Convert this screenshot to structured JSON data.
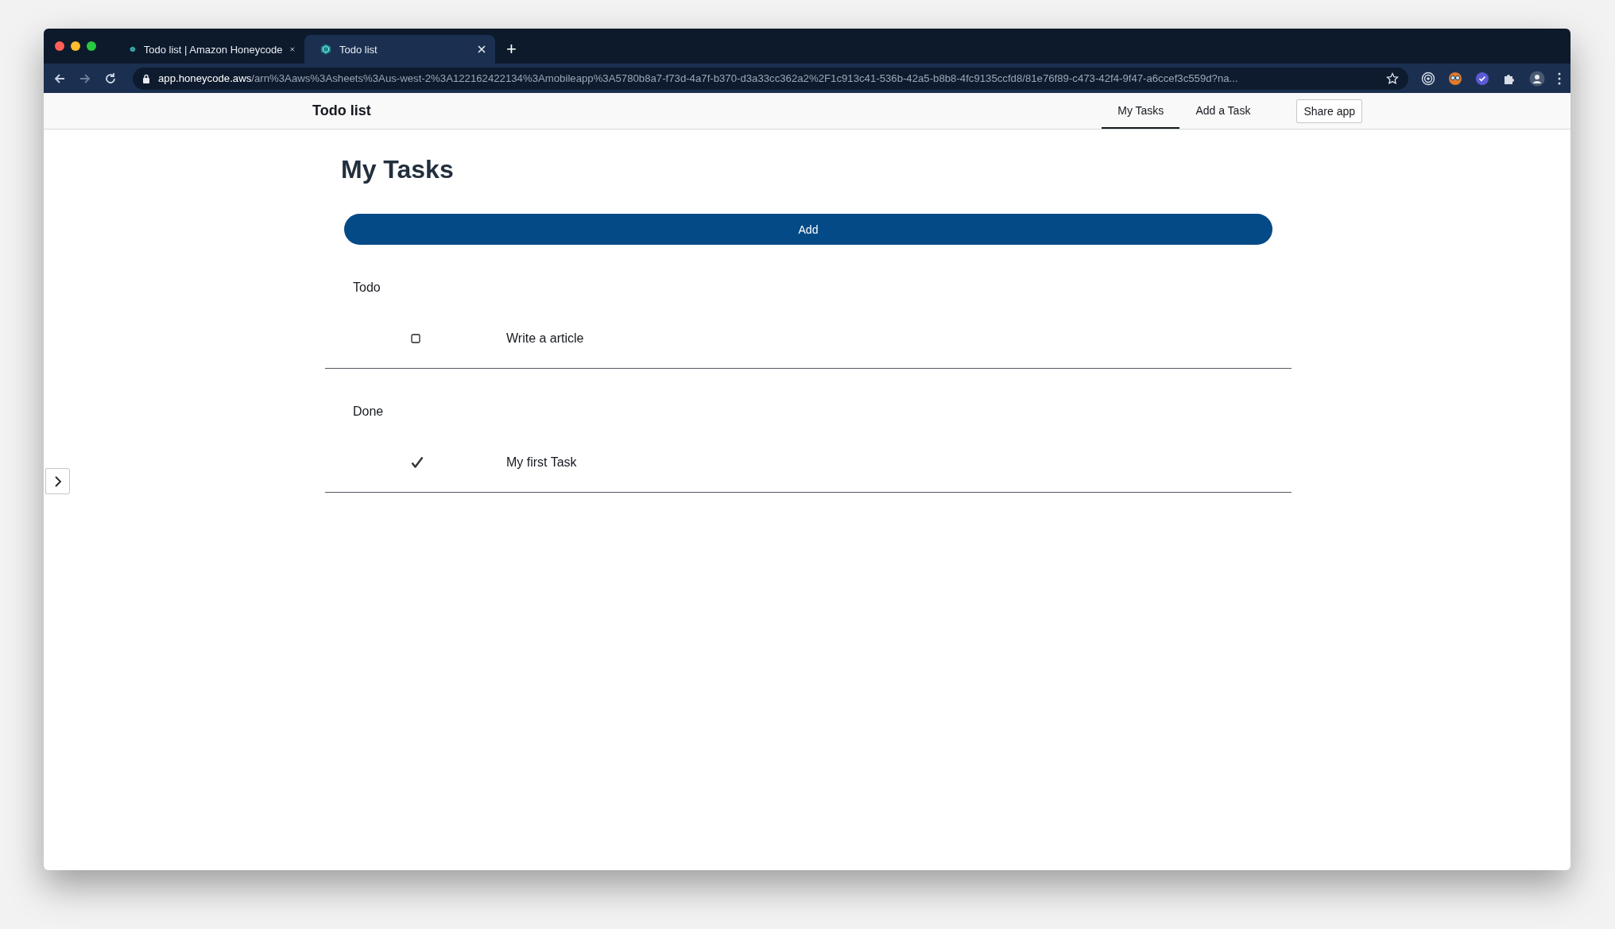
{
  "browser": {
    "tabs": [
      {
        "title": "Todo list | Amazon Honeycode",
        "selected": false
      },
      {
        "title": "Todo list",
        "selected": true
      }
    ],
    "new_tab": "+",
    "url_host": "app.honeycode.aws",
    "url_path": "/arn%3Aaws%3Asheets%3Aus-west-2%3A122162422134%3Amobileapp%3A5780b8a7-f73d-4a7f-b370-d3a33cc362a2%2F1c913c41-536b-42a5-b8b8-4fc9135ccfd8/81e76f89-c473-42f4-9f47-a6ccef3c559d?na..."
  },
  "app": {
    "title": "Todo list",
    "nav": [
      {
        "label": "My Tasks",
        "selected": true
      },
      {
        "label": "Add a Task",
        "selected": false
      }
    ],
    "share_button": "Share app"
  },
  "page": {
    "heading": "My Tasks",
    "add_button": "Add",
    "sections": [
      {
        "label": "Todo",
        "tasks": [
          {
            "title": "Write a article",
            "checked": false
          }
        ]
      },
      {
        "label": "Done",
        "tasks": [
          {
            "title": "My first Task",
            "checked": true
          }
        ]
      }
    ]
  }
}
